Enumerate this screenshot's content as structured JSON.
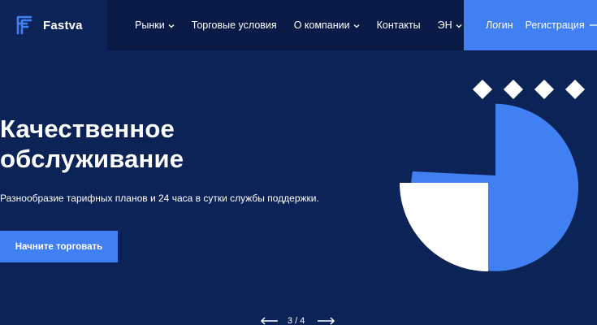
{
  "brand": {
    "name": "Fastva",
    "logo_icon": "f-logo-icon",
    "logo_color": "#4180f2"
  },
  "nav": {
    "items": [
      {
        "label": "Рынки",
        "has_dropdown": true
      },
      {
        "label": "Торговые условия",
        "has_dropdown": false
      },
      {
        "label": "О компании",
        "has_dropdown": true
      },
      {
        "label": "Контакты",
        "has_dropdown": false
      },
      {
        "label": "ЭН",
        "has_dropdown": true
      }
    ]
  },
  "auth": {
    "login_label": "Логин",
    "register_label": "Регистрация"
  },
  "hero": {
    "title_line1": "Качественное",
    "title_line2": "обслуживание",
    "subtitle": "Разнообразие тарифных планов и 24 часа в сутки службы поддержки.",
    "cta_label": "Начните торговать"
  },
  "slider": {
    "counter": "3 / 4",
    "current": 3,
    "total": 4
  },
  "colors": {
    "background": "#0c2357",
    "nav_background": "#081a45",
    "accent": "#4180f2",
    "text": "#ffffff"
  }
}
